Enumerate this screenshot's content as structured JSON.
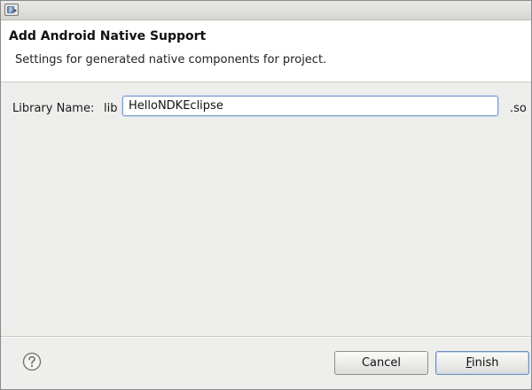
{
  "header": {
    "title": "Add Android Native Support",
    "message": "Settings for generated native components for project."
  },
  "library": {
    "label": "Library Name:",
    "prefix": "lib",
    "value": "HelloNDKEclipse",
    "suffix": ".so"
  },
  "buttons": {
    "cancel_label": "Cancel",
    "finish_mnemonic": "F",
    "finish_rest": "inish"
  },
  "icons": {
    "window": "eclipse-window-icon",
    "help": "help-question-icon"
  }
}
